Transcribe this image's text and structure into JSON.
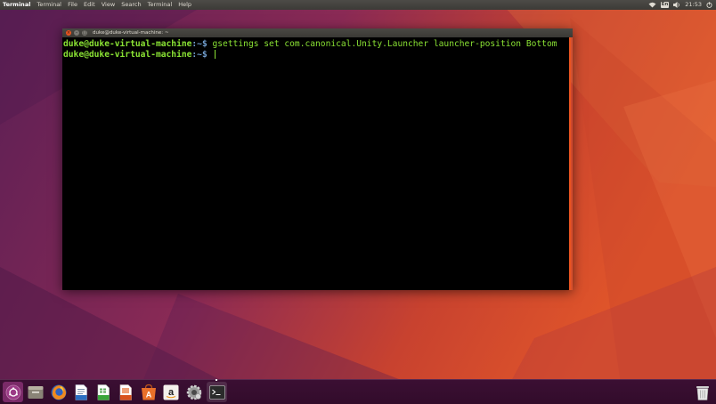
{
  "top_panel": {
    "app_name": "Terminal",
    "menus": [
      "Terminal",
      "File",
      "Edit",
      "View",
      "Search",
      "Terminal",
      "Help"
    ],
    "keyboard_layout": "En",
    "time": "21:53",
    "icons": [
      "wifi-icon",
      "keyboard-layout-indicator",
      "volume-icon",
      "clock",
      "power-icon"
    ]
  },
  "terminal": {
    "title": "duke@duke-virtual-machine: ~",
    "lines": [
      {
        "user_host": "duke@duke-virtual-machine",
        "path": ":~$",
        "command": " gsettings set com.canonical.Unity.Launcher launcher-position Bottom"
      },
      {
        "user_host": "duke@duke-virtual-machine",
        "path": ":~$",
        "command": " "
      }
    ]
  },
  "launcher": {
    "items": [
      {
        "name": "dash-home-icon"
      },
      {
        "name": "files-icon"
      },
      {
        "name": "firefox-icon"
      },
      {
        "name": "libreoffice-writer-icon"
      },
      {
        "name": "libreoffice-calc-icon"
      },
      {
        "name": "libreoffice-impress-icon"
      },
      {
        "name": "ubuntu-software-icon"
      },
      {
        "name": "amazon-icon"
      },
      {
        "name": "system-settings-icon"
      },
      {
        "name": "terminal-icon"
      },
      {
        "name": "trash-icon"
      }
    ]
  },
  "colors": {
    "accent": "#e95420",
    "prompt_user": "#8ae234",
    "prompt_path": "#729fcf",
    "launcher_bg": "#3b0f33"
  }
}
